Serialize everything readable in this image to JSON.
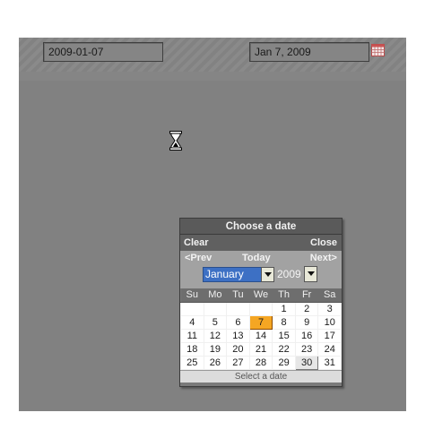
{
  "fields": {
    "iso_value": "2009-01-07",
    "long_value": "Jan 7, 2009"
  },
  "icons": {
    "calendar_trigger": "calendar-icon",
    "cursor": "hourglass-icon"
  },
  "calendar": {
    "title": "Choose a date",
    "clear_label": "Clear",
    "close_label": "Close",
    "prev_label": "<Prev",
    "today_label": "Today",
    "next_label": "Next>",
    "month": "January",
    "year": "2009",
    "weekdays": [
      "Su",
      "Mo",
      "Tu",
      "We",
      "Th",
      "Fr",
      "Sa"
    ],
    "weeks": [
      [
        "",
        "",
        "",
        "",
        "1",
        "2",
        "3"
      ],
      [
        "4",
        "5",
        "6",
        "7",
        "8",
        "9",
        "10"
      ],
      [
        "11",
        "12",
        "13",
        "14",
        "15",
        "16",
        "17"
      ],
      [
        "18",
        "19",
        "20",
        "21",
        "22",
        "23",
        "24"
      ],
      [
        "25",
        "26",
        "27",
        "28",
        "29",
        "30",
        "31"
      ]
    ],
    "selected_day": "7",
    "hover_day": "30",
    "status_text": "Select a date",
    "colors": {
      "selected": "#f5a623",
      "month_select": "#3d70c4"
    }
  }
}
